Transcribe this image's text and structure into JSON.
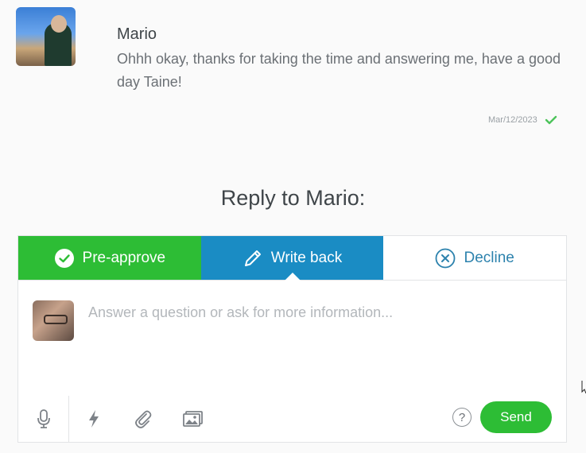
{
  "message": {
    "sender_name": "Mario",
    "text": "Ohhh okay, thanks for taking the time and answering me, have a good day Taine!",
    "date": "Mar/12/2023",
    "status_icon": "check-icon"
  },
  "reply": {
    "title": "Reply to Mario:",
    "tabs": [
      {
        "label": "Pre-approve",
        "icon": "check-circle-icon",
        "color": "#2dbd35"
      },
      {
        "label": "Write back",
        "icon": "pencil-icon",
        "color": "#1a8cc4",
        "active": true
      },
      {
        "label": "Decline",
        "icon": "x-circle-icon",
        "color": "#2c82ad"
      }
    ],
    "placeholder": "Answer a question or ask for more information...",
    "send_label": "Send",
    "help_label": "?"
  },
  "toolbar": {
    "icons": [
      "microphone-icon",
      "lightning-icon",
      "paperclip-icon",
      "image-icon"
    ]
  }
}
